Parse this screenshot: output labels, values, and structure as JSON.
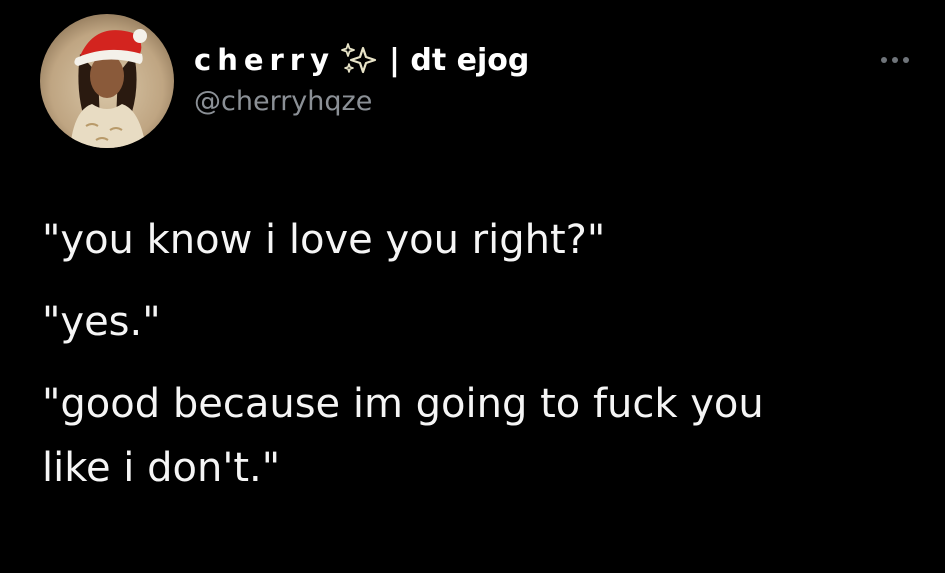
{
  "author": {
    "display_name": "cherry",
    "name_badge_icon": "sparkles-icon",
    "name_suffix": "| dt ejog",
    "handle": "@cherryhqze",
    "avatar_icon": "profile-photo-santa-hat"
  },
  "actions": {
    "more_icon": "more-horizontal-icon"
  },
  "tweet": {
    "lines": [
      "\"you know i love you right?\"",
      "\"yes.\"",
      "\"good because im going to fuck you",
      "like i don't.\""
    ]
  },
  "colors": {
    "background": "#000000",
    "text": "#f5f5f5",
    "handle": "#8b9096",
    "icon": "#6f747a",
    "sparkle": "#e8e4c8"
  }
}
